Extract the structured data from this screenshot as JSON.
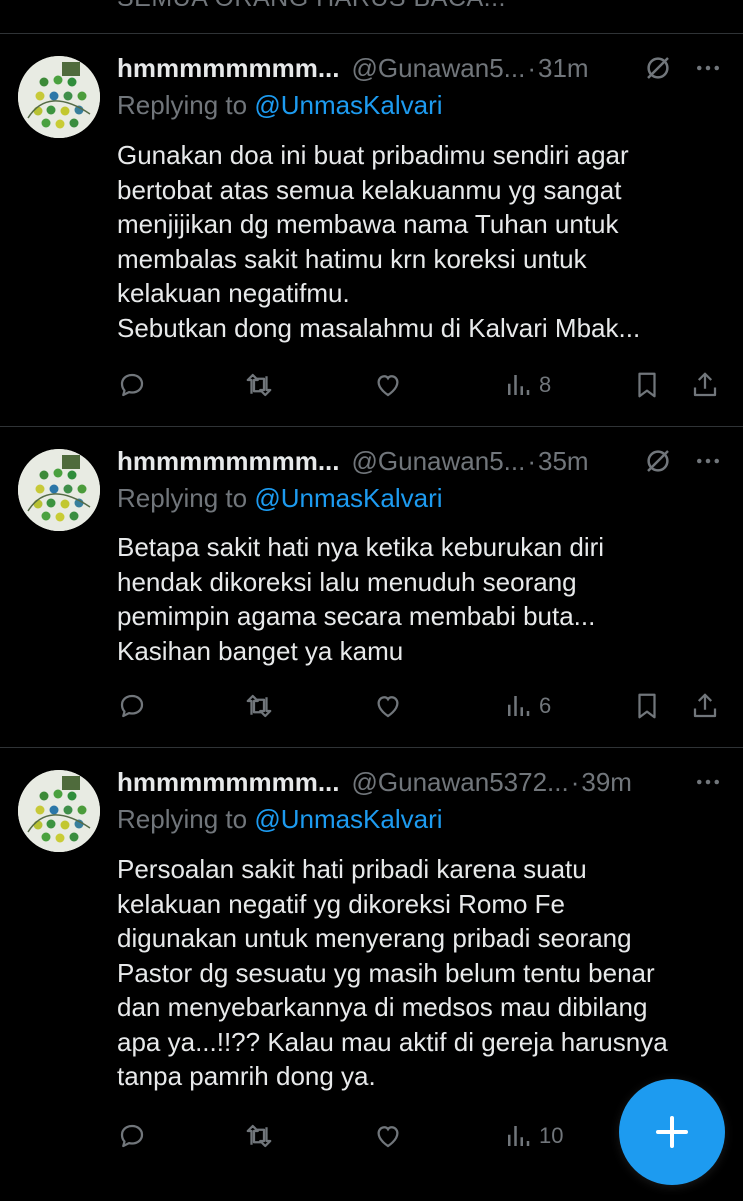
{
  "top_cut_text": "SEMUA ORANG HARUS BACA...",
  "tweets": [
    {
      "name": "hmmmmmmmm...",
      "handle": "@Gunawan5...",
      "time": "31m",
      "replying_prefix": "Replying to ",
      "replying_to": "@UnmasKalvari",
      "lines": [
        "Gunakan doa ini buat pribadimu sendiri agar",
        "bertobat atas semua kelakuanmu yg sangat",
        "menjijikan dg membawa nama Tuhan untuk",
        "membalas sakit hatimu krn koreksi untuk",
        "kelakuan negatifmu.",
        "Sebutkan dong masalahmu di Kalvari Mbak..."
      ],
      "views": "8"
    },
    {
      "name": "hmmmmmmmm...",
      "handle": "@Gunawan5...",
      "time": "35m",
      "replying_prefix": "Replying to ",
      "replying_to": "@UnmasKalvari",
      "lines": [
        "Betapa sakit hati nya ketika keburukan diri",
        "hendak dikoreksi lalu menuduh seorang",
        "pemimpin agama secara membabi buta...",
        "Kasihan banget ya kamu"
      ],
      "views": "6"
    },
    {
      "name": "hmmmmmmmm...",
      "handle": "@Gunawan5372...",
      "time": "39m",
      "replying_prefix": "Replying to ",
      "replying_to": "@UnmasKalvari",
      "lines": [
        "Persoalan sakit hati pribadi karena suatu",
        "kelakuan negatif yg dikoreksi Romo Fe",
        "digunakan untuk menyerang pribadi seorang",
        "Pastor dg sesuatu yg masih belum tentu benar",
        "dan menyebarkannya di medsos mau dibilang",
        "apa ya...!!?? Kalau mau aktif di gereja harusnya",
        "tanpa pamrih dong ya."
      ],
      "views": "10"
    }
  ],
  "separator": "·",
  "icons": {
    "reply": "reply-icon",
    "retweet": "retweet-icon",
    "like": "like-icon",
    "views": "views-icon",
    "bookmark": "bookmark-icon",
    "share": "share-icon",
    "grok": "grok-icon",
    "more": "more-icon",
    "compose": "plus-icon"
  },
  "colors": {
    "background": "#000000",
    "text": "#e7e9ea",
    "muted": "#71767b",
    "accent": "#1d9bf0",
    "divider": "#2f3336"
  }
}
